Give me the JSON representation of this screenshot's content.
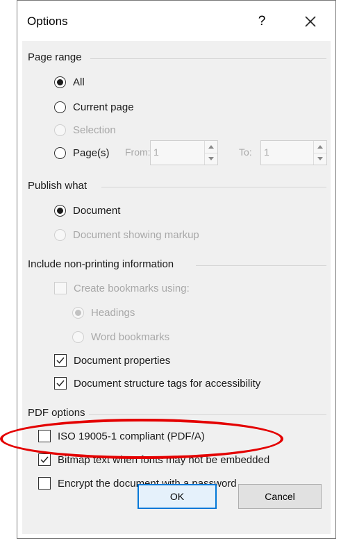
{
  "dialog": {
    "title": "Options",
    "help_label": "?",
    "close_icon": "close-icon"
  },
  "page_range": {
    "label": "Page range",
    "all": "All",
    "current_page": "Current page",
    "selection": "Selection",
    "pages": "Page(s)",
    "from_label": "From:",
    "from_value": "1",
    "to_label": "To:",
    "to_value": "1",
    "selected": "All"
  },
  "publish_what": {
    "label": "Publish what",
    "document": "Document",
    "document_markup": "Document showing markup",
    "selected": "Document"
  },
  "non_printing": {
    "label": "Include non-printing information",
    "create_bookmarks": "Create bookmarks using:",
    "headings": "Headings",
    "word_bookmarks": "Word bookmarks",
    "document_properties": "Document properties",
    "structure_tags": "Document structure tags for accessibility",
    "create_bookmarks_checked": false,
    "document_properties_checked": true,
    "structure_tags_checked": true
  },
  "pdf_options": {
    "label": "PDF options",
    "iso": "ISO 19005-1 compliant (PDF/A)",
    "bitmap_text": "Bitmap text when fonts may not be embedded",
    "encrypt": "Encrypt the document with a password",
    "iso_checked": false,
    "bitmap_text_checked": true,
    "encrypt_checked": false
  },
  "buttons": {
    "ok": "OK",
    "cancel": "Cancel"
  },
  "colors": {
    "highlight": "#e40000",
    "default_button_border": "#0078d7",
    "panel_background": "#f0f0f0"
  }
}
